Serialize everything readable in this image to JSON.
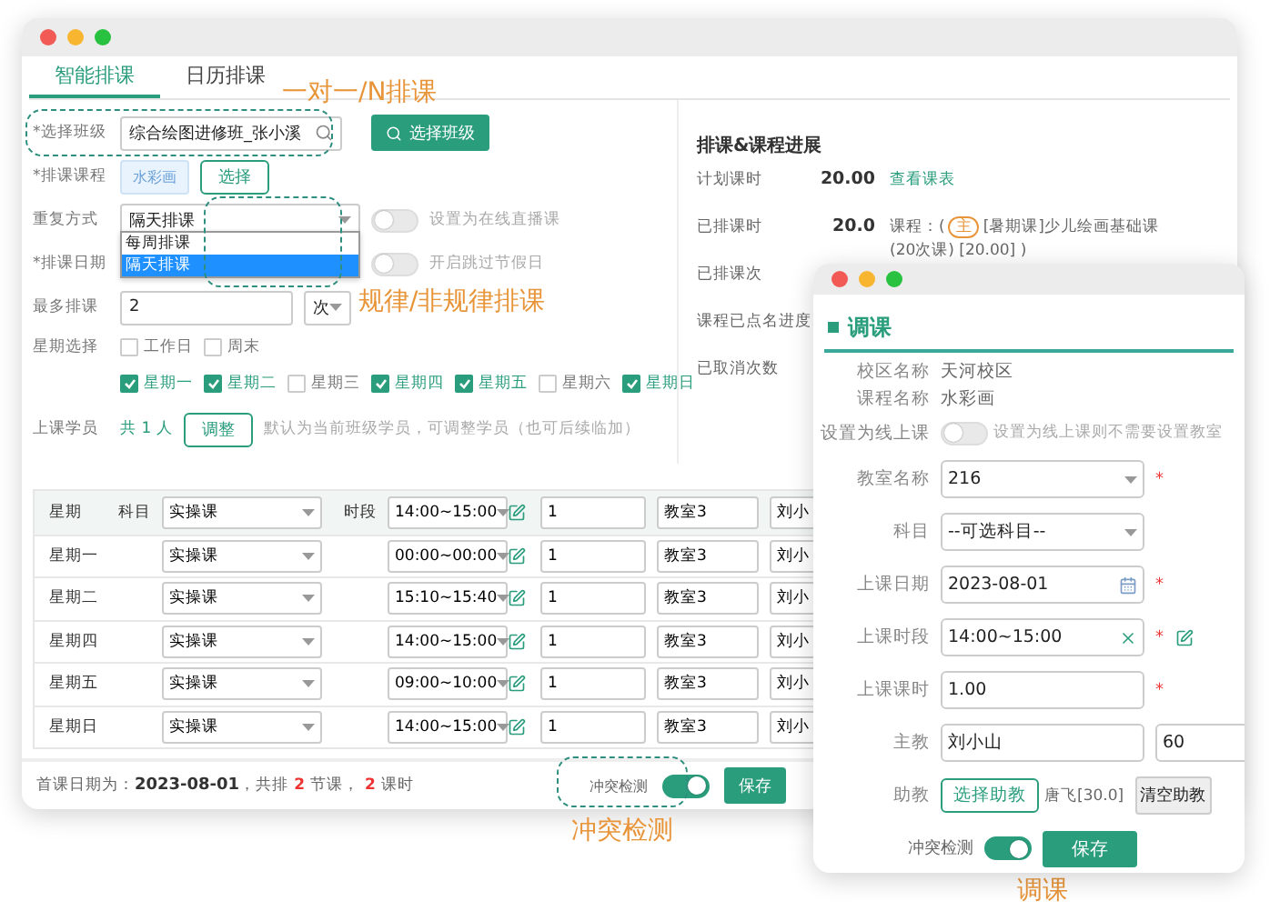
{
  "main_window": {
    "tabs": [
      {
        "label": "智能排课",
        "selected": true
      },
      {
        "label": "日历排课",
        "selected": false
      }
    ],
    "form": {
      "class_field": {
        "label": "*选择班级",
        "value": "综合绘图进修班_张小溪",
        "button": "选择班级"
      },
      "course": {
        "label": "*排课课程",
        "chip": "水彩画",
        "button": "选择"
      },
      "repeat": {
        "label": "重复方式",
        "value": "隔天排课",
        "options": [
          {
            "label": "每周排课",
            "selected": false
          },
          {
            "label": "隔天排课",
            "selected": true
          }
        ],
        "toggle": {
          "label": "设置为在线直播课",
          "on": false
        }
      },
      "date": {
        "label": "*排课日期",
        "toggle": {
          "label": "开启跳过节假日",
          "on": false
        }
      },
      "max": {
        "label": "最多排课",
        "value": "2",
        "unit": "次"
      },
      "week": {
        "label": "星期选择",
        "groups": [
          {
            "label": "工作日",
            "checked": false
          },
          {
            "label": "周末",
            "checked": false
          }
        ],
        "days": [
          {
            "label": "星期一",
            "checked": true
          },
          {
            "label": "星期二",
            "checked": true
          },
          {
            "label": "星期三",
            "checked": false
          },
          {
            "label": "星期四",
            "checked": true
          },
          {
            "label": "星期五",
            "checked": true
          },
          {
            "label": "星期六",
            "checked": false
          },
          {
            "label": "星期日",
            "checked": true
          }
        ]
      },
      "students": {
        "label": "上课学员",
        "count": "共 1 人",
        "button": "调整",
        "hint": "默认为当前班级学员，可调整学员（也可后续临加）"
      }
    },
    "progress": {
      "title": "排课&课程进展",
      "rows": [
        {
          "label": "计划课时",
          "value": "20.00",
          "link": "查看课表"
        },
        {
          "label": "已排课时",
          "value": "20.0",
          "prefix": "课程：(",
          "tag": "主",
          "detail": "[暑期课]少儿绘画基础课(20次课) [20.00] )"
        },
        {
          "label": "已排课次"
        },
        {
          "label": "课程已点名进度"
        },
        {
          "label": "已取消次数"
        }
      ]
    },
    "schedule_table": {
      "header": {
        "day": "星期",
        "subject_label": "科目",
        "subject": "实操课",
        "time_label": "时段",
        "time": "14:00~15:00",
        "hours": "1",
        "room": "教室3",
        "teacher": "刘小"
      },
      "rows": [
        {
          "day": "星期一",
          "subject": "实操课",
          "time": "00:00~00:00",
          "hours": "1",
          "room": "教室3",
          "teacher": "刘小"
        },
        {
          "day": "星期二",
          "subject": "实操课",
          "time": "15:10~15:40",
          "hours": "1",
          "room": "教室3",
          "teacher": "刘小"
        },
        {
          "day": "星期四",
          "subject": "实操课",
          "time": "14:00~15:00",
          "hours": "1",
          "room": "教室3",
          "teacher": "刘小"
        },
        {
          "day": "星期五",
          "subject": "实操课",
          "time": "09:00~10:00",
          "hours": "1",
          "room": "教室3",
          "teacher": "刘小"
        },
        {
          "day": "星期日",
          "subject": "实操课",
          "time": "14:00~15:00",
          "hours": "1",
          "room": "教室3",
          "teacher": "刘小"
        }
      ]
    },
    "footer": {
      "date_label": "首课日期为：",
      "date": "2023-08-01",
      "lessons_prefix": "，共排",
      "lessons": "2",
      "lessons_suffix": "节课，",
      "hours": "2",
      "hours_suffix": "课时",
      "conflict": {
        "label": "冲突检测",
        "on": true
      },
      "save": "保存"
    }
  },
  "dialog": {
    "title": "调课",
    "info": [
      {
        "label": "校区名称",
        "value": "天河校区"
      },
      {
        "label": "课程名称",
        "value": "水彩画"
      }
    ],
    "online": {
      "label": "设置为线上课",
      "on": false,
      "hint": "设置为线上课则不需要设置教室"
    },
    "fields": [
      {
        "kind": "select",
        "label": "教室名称",
        "value": "216",
        "mark": "*"
      },
      {
        "kind": "select",
        "label": "科目",
        "value": "--可选科目--"
      },
      {
        "kind": "date",
        "label": "上课日期",
        "value": "2023-08-01",
        "mark": "*"
      },
      {
        "kind": "time",
        "label": "上课时段",
        "value": "14:00~15:00",
        "mark": "*"
      },
      {
        "kind": "text",
        "label": "上课课时",
        "value": "1.00",
        "mark": "*"
      },
      {
        "kind": "teacher",
        "label": "主教",
        "value": "刘小山",
        "extra": "60"
      }
    ],
    "assistant": {
      "label": "助教",
      "button": "选择助教",
      "value": "唐飞[30.0]",
      "clear": "清空助教"
    },
    "conflict": {
      "label": "冲突检测",
      "on": true
    },
    "save": "保存"
  },
  "annotations": [
    "一对一/N排课",
    "规律/非规律排课",
    "冲突检测",
    "调课"
  ]
}
